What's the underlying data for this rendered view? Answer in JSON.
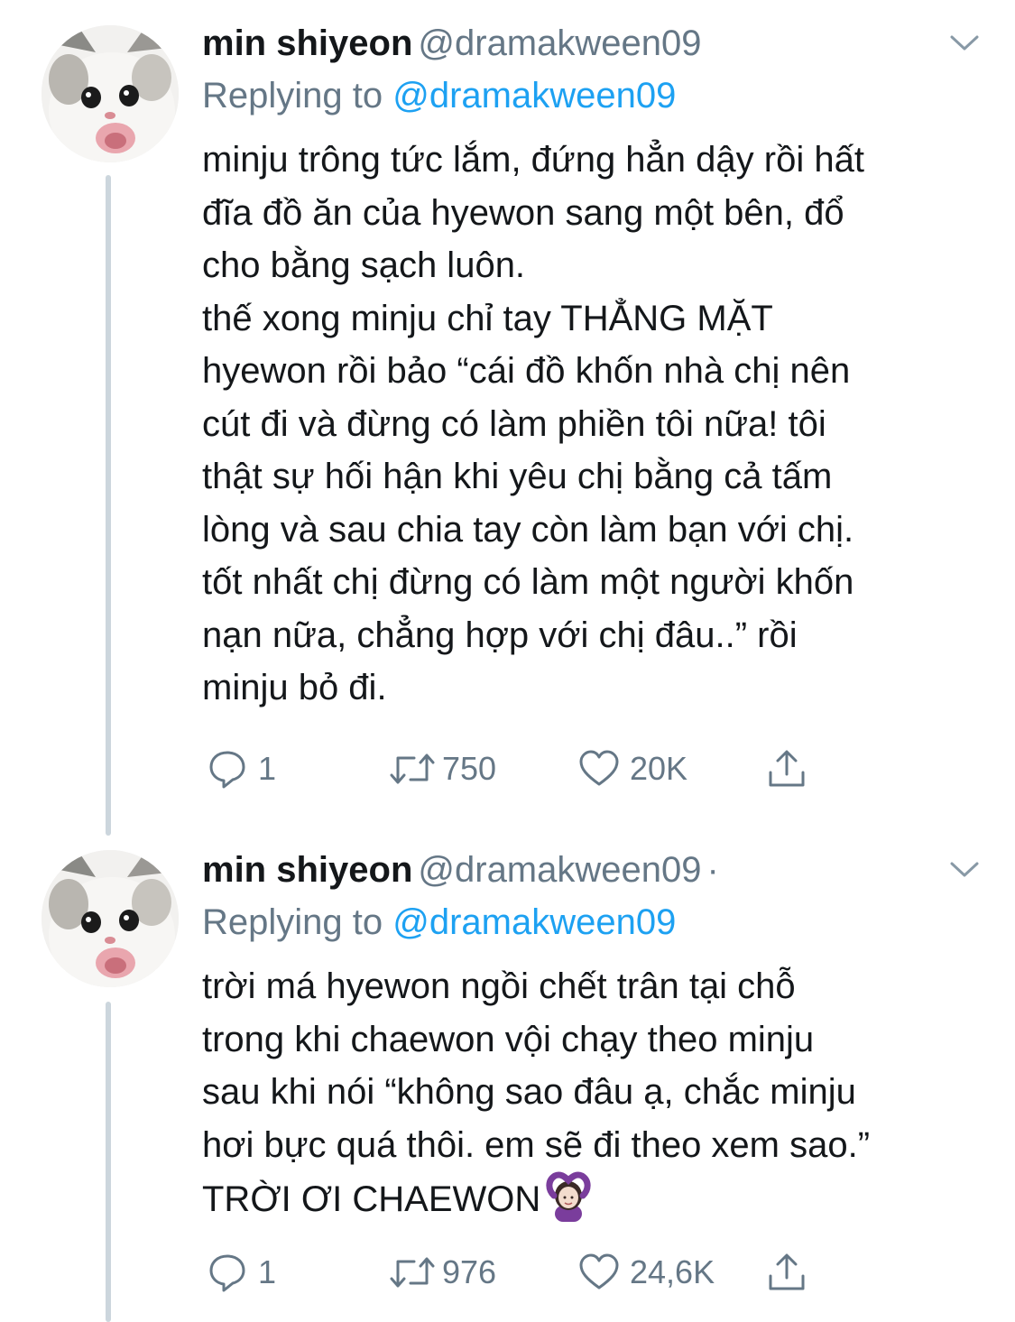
{
  "tweets": [
    {
      "display_name": "min shiyeon",
      "handle": "@dramakween09",
      "separator": "",
      "replying_prefix": "Replying to ",
      "replying_to": "@dramakween09",
      "text": "minju trông tức lắm, đứng hẳn dậy rồi hất\nđĩa đồ ăn của hyewon sang một bên, đổ\ncho bằng sạch luôn.\nthế xong minju chỉ tay THẲNG MẶT\nhyewon rồi bảo “cái đồ khốn nhà chị nên\ncút đi và đừng có làm phiền tôi nữa! tôi\nthật sự hối hận khi yêu chị bằng cả tấm\nlòng và sau chia tay còn làm bạn với chị.\ntốt nhất chị đừng có làm một người khốn\nnạn nữa, chẳng hợp với chị đâu..” rồi\nminju bỏ đi.",
      "replies": "1",
      "retweets": "750",
      "likes": "20K"
    },
    {
      "display_name": "min shiyeon",
      "handle": "@dramakween09",
      "separator": "·",
      "replying_prefix": "Replying to ",
      "replying_to": "@dramakween09",
      "text": "trời má hyewon ngồi chết trân tại chỗ\ntrong khi chaewon vội chạy theo minju\nsau khi nói “không sao đâu ạ, chắc minju\nhơi bực quá thôi. em sẽ đi theo xem sao.”\nTRỜI ƠI CHAEWON",
      "emoji": "person-gesturing-ok-emoji",
      "replies": "1",
      "retweets": "976",
      "likes": "24,6K"
    }
  ],
  "icons": {
    "reply": "reply-icon",
    "retweet": "retweet-icon",
    "like": "heart-icon",
    "share": "share-icon",
    "more": "chevron-down-icon"
  },
  "colors": {
    "text": "#14171a",
    "secondary": "#657786",
    "link": "#1da1f2",
    "thread_line": "#ccd6dd",
    "background": "#ffffff"
  }
}
